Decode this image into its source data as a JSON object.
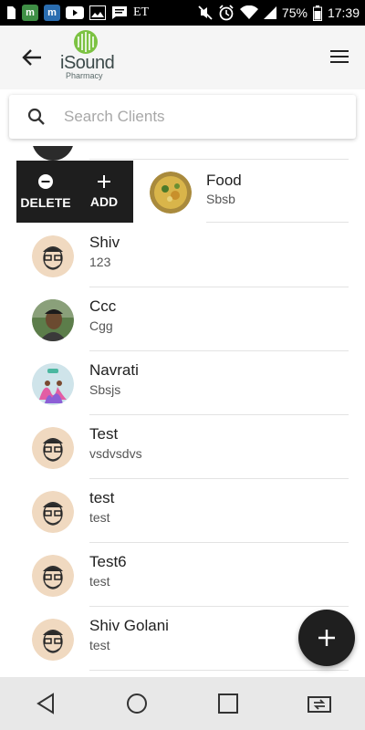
{
  "status_bar": {
    "time": "17:39",
    "battery": "75%",
    "icons": [
      "sim-icon",
      "m-app-icon",
      "m-app-icon",
      "youtube-icon",
      "gallery-icon",
      "message-icon",
      "et-icon",
      "mute-icon",
      "alarm-icon",
      "wifi-icon",
      "signal-icon",
      "battery-icon"
    ],
    "et_label": "ET",
    "m_label": "m"
  },
  "app_bar": {
    "back_icon": "arrow-back-icon",
    "logo_text": "iSound",
    "logo_sub": "Pharmacy",
    "menu_icon": "hamburger-icon"
  },
  "search": {
    "placeholder": "Search Clients",
    "value": ""
  },
  "swipe_actions": {
    "delete_label": "DELETE",
    "add_label": "ADD"
  },
  "clients": [
    {
      "name": "Food",
      "sub": "Sbsb",
      "avatar": "food"
    },
    {
      "name": "Shiv",
      "sub": "123",
      "avatar": "sketch"
    },
    {
      "name": "Ccc",
      "sub": "Cgg",
      "avatar": "photo"
    },
    {
      "name": "Navrati",
      "sub": "Sbsjs",
      "avatar": "dance"
    },
    {
      "name": "Test",
      "sub": "vsdvsdvs",
      "avatar": "sketch"
    },
    {
      "name": "test",
      "sub": "test",
      "avatar": "sketch"
    },
    {
      "name": "Test6",
      "sub": "test",
      "avatar": "sketch"
    },
    {
      "name": "Shiv Golani",
      "sub": "test",
      "avatar": "sketch"
    }
  ],
  "fab": {
    "icon": "plus-icon"
  },
  "nav_bar": {
    "icons": [
      "back-triangle-icon",
      "home-circle-icon",
      "recents-square-icon",
      "switch-sim-icon"
    ]
  },
  "colors": {
    "accent": "#1f1f1f",
    "logo_green": "#7cc242",
    "divider": "#e3e3e3"
  }
}
